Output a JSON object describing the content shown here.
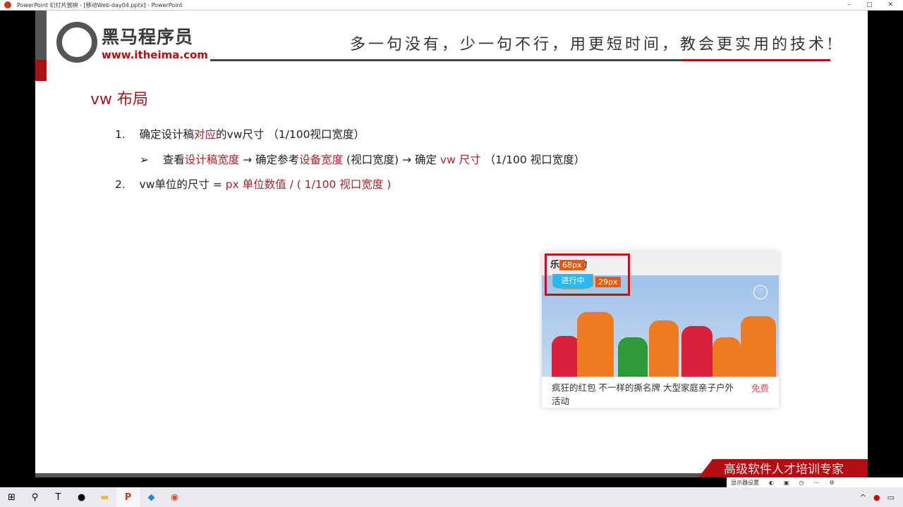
{
  "window": {
    "title": "PowerPoint 幻灯片放映 - [移动Web-day04.pptx] - PowerPoint",
    "min": "–",
    "max": "▢",
    "close": "✕"
  },
  "slide": {
    "brand": "黑马程序员",
    "url": "www.itheima.com",
    "slogan": "多一句没有，少一句不行，用更短时间，教会更实用的技术!",
    "heading": "vw 布局",
    "item1": {
      "num": "1.",
      "a": "确定设计稿",
      "b": "对应",
      "c": "的vw尺寸 （1/100视口宽度）"
    },
    "sub": {
      "bullet": "➢",
      "a": "查看",
      "b": "设计稿宽度",
      "c": " → 确定参考",
      "d": "设备宽度",
      "e": " (视口宽度) → 确定 ",
      "f": "vw 尺寸",
      "g": " （1/100 视口宽度）"
    },
    "item2": {
      "num": "2.",
      "a": "vw单位的尺寸 = ",
      "b": "px 单位数值 / ( 1/100 视口宽度 )"
    },
    "card": {
      "title": "乐园活动",
      "status": "进行中",
      "width_tag": "68px",
      "height_tag": "29px",
      "desc": "疯狂的红包 不一样的撕名牌 大型家庭亲子户外活动",
      "price": "免费",
      "heart": "♡"
    },
    "banner": "高级软件人才培训专家"
  },
  "presenter": {
    "items": [
      "显示器设置",
      "◐",
      "▣",
      "◷",
      "⋯",
      "⚙"
    ]
  },
  "taskbar": {
    "apps": [
      {
        "name": "start",
        "glyph": "⊞"
      },
      {
        "name": "search",
        "glyph": "⚲"
      },
      {
        "name": "typora",
        "glyph": "T"
      },
      {
        "name": "obs",
        "glyph": "●"
      },
      {
        "name": "explorer",
        "glyph": "▬"
      },
      {
        "name": "powerpoint",
        "glyph": "P"
      },
      {
        "name": "vscode",
        "glyph": "◆"
      },
      {
        "name": "chrome",
        "glyph": "◉"
      }
    ],
    "tray": [
      "^",
      "●",
      "▭"
    ]
  }
}
